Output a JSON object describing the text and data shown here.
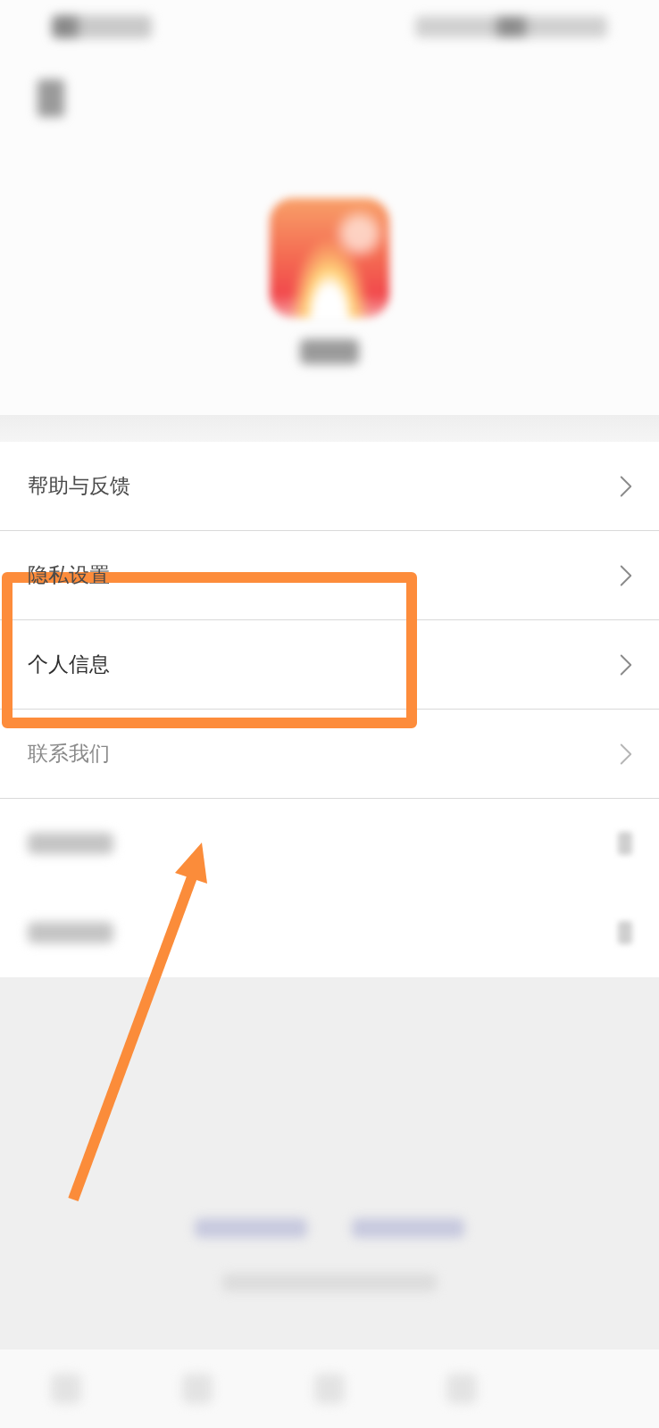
{
  "menu": {
    "items": [
      {
        "kind": "text",
        "label": "帮助与反馈",
        "dimmed": false
      },
      {
        "kind": "text",
        "label": "隐私设置",
        "dimmed": false
      },
      {
        "kind": "text",
        "label": "个人信息",
        "dimmed": false
      },
      {
        "kind": "text",
        "label": "联系我们",
        "dimmed": true
      },
      {
        "kind": "blurred",
        "dimmed": false
      },
      {
        "kind": "blurred",
        "dimmed": false
      }
    ]
  }
}
